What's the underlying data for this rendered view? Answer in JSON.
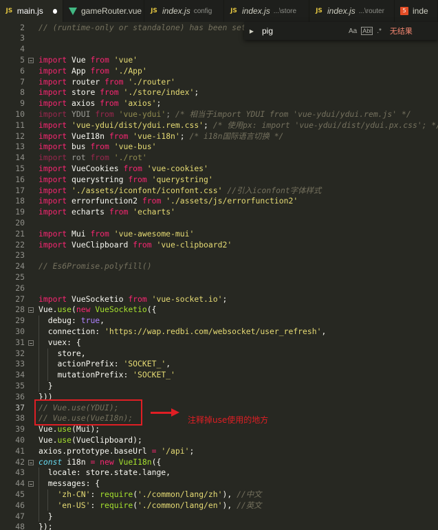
{
  "tabs": [
    {
      "label": "main.js",
      "icon": "js-file-icon",
      "active": true,
      "modified": true,
      "desc": ""
    },
    {
      "label": "gameRouter.vue",
      "icon": "vue-file-icon",
      "active": false,
      "modified": false,
      "desc": ""
    },
    {
      "label": "index.js",
      "icon": "js-file-icon",
      "active": false,
      "modified": false,
      "desc": "config"
    },
    {
      "label": "index.js",
      "icon": "js-file-icon",
      "active": false,
      "modified": false,
      "desc": "...\\store"
    },
    {
      "label": "index.js",
      "icon": "js-file-icon",
      "active": false,
      "modified": false,
      "desc": "...\\router"
    },
    {
      "label": "inde",
      "icon": "html-file-icon",
      "active": false,
      "modified": false,
      "desc": ""
    }
  ],
  "find": {
    "query": "pig",
    "match_case_label": "Aa",
    "whole_word_label": "Abl",
    "regex_label": ".*",
    "result": "无结果"
  },
  "annotation": {
    "note": "注释掉use使用的地方",
    "color": "#e01e24"
  },
  "code_lines": [
    {
      "n": "2",
      "html": "<span class='c'>// (runtime-only or standalone) has been set in</span>"
    },
    {
      "n": "3",
      "html": ""
    },
    {
      "n": "4",
      "html": ""
    },
    {
      "n": "5",
      "fold": true,
      "html": "<span class='k'>import</span> <span class='p'>Vue</span> <span class='k'>from</span> <span class='s'>'vue'</span>"
    },
    {
      "n": "6",
      "html": "<span class='k'>import</span> <span class='p'>App</span> <span class='k'>from</span> <span class='s'>'./App'</span>"
    },
    {
      "n": "7",
      "html": "<span class='k'>import</span> <span class='p'>router</span> <span class='k'>from</span> <span class='s'>'./router'</span>"
    },
    {
      "n": "8",
      "html": "<span class='k'>import</span> <span class='p'>store</span> <span class='k'>from</span> <span class='s'>'./store/index'</span><span class='p'>;</span>"
    },
    {
      "n": "9",
      "html": "<span class='k'>import</span> <span class='p'>axios</span> <span class='k'>from</span> <span class='s'>'axios'</span><span class='p'>;</span>"
    },
    {
      "n": "10",
      "html": "<span class='dim'><span class='k'>import</span> <span class='p'>YDUI</span> <span class='k'>from</span> <span class='s'>'vue-ydui'</span><span class='p'>;</span></span> <span class='c'>/* 相当于import YDUI from 'vue-ydui/ydui.rem.js' */</span>"
    },
    {
      "n": "11",
      "html": "<span class='k'>import</span> <span class='s'>'vue-ydui/dist/ydui.rem.css'</span><span class='p'>;</span> <span class='c'>/* 使用px: import 'vue-ydui/dist/ydui.px.css'; */</span>"
    },
    {
      "n": "12",
      "html": "<span class='k'>import</span> <span class='p'>VueI18n</span> <span class='k'>from</span> <span class='s'>'vue-i18n'</span><span class='p'>;</span> <span class='c'>/* i18n国际语言切换 */</span>"
    },
    {
      "n": "13",
      "html": "<span class='k'>import</span> <span class='p'>bus</span> <span class='k'>from</span> <span class='s'>'vue-bus'</span>"
    },
    {
      "n": "14",
      "html": "<span class='dim'><span class='k'>import</span> <span class='p'>rot</span> <span class='k'>from</span> <span class='s'>'./rot'</span></span>"
    },
    {
      "n": "15",
      "html": "<span class='k'>import</span> <span class='p'>VueCookies</span> <span class='k'>from</span> <span class='s'>'vue-cookies'</span>"
    },
    {
      "n": "16",
      "html": "<span class='k'>import</span> <span class='p'>querystring</span> <span class='k'>from</span> <span class='s'>'querystring'</span>"
    },
    {
      "n": "17",
      "html": "<span class='k'>import</span> <span class='s'>'./assets/iconfont/iconfont.css'</span> <span class='c'>//引入iconfont字体样式</span>"
    },
    {
      "n": "18",
      "html": "<span class='k'>import</span> <span class='p'>errorfunction2</span> <span class='k'>from</span> <span class='s'>'./assets/js/errorfunction2'</span>"
    },
    {
      "n": "19",
      "html": "<span class='k'>import</span> <span class='p'>echarts</span> <span class='k'>from</span> <span class='s'>'echarts'</span>"
    },
    {
      "n": "20",
      "html": ""
    },
    {
      "n": "21",
      "html": "<span class='k'>import</span> <span class='p'>Mui</span> <span class='k'>from</span> <span class='s'>'vue-awesome-mui'</span>"
    },
    {
      "n": "22",
      "html": "<span class='k'>import</span> <span class='p'>VueClipboard</span> <span class='k'>from</span> <span class='s'>'vue-clipboard2'</span>"
    },
    {
      "n": "23",
      "html": ""
    },
    {
      "n": "24",
      "html": "<span class='c'>// Es6Promise.polyfill()</span>"
    },
    {
      "n": "25",
      "html": ""
    },
    {
      "n": "26",
      "html": ""
    },
    {
      "n": "27",
      "html": "<span class='k'>import</span> <span class='p'>VueSocketio</span> <span class='k'>from</span> <span class='s'>'vue-socket.io'</span><span class='p'>;</span>"
    },
    {
      "n": "28",
      "fold": true,
      "html": "<span class='p'>Vue.</span><span class='f'>use</span><span class='p'>(</span><span class='k'>new</span> <span class='f'>VueSocketio</span><span class='p'>({</span>"
    },
    {
      "n": "29",
      "html": "  <span class='p'>debug:</span> <span class='b'>true</span><span class='p'>,</span>"
    },
    {
      "n": "30",
      "html": "  <span class='p'>connection:</span> <span class='s'>'https://wap.redbi.com/websocket/user_refresh'</span><span class='p'>,</span>"
    },
    {
      "n": "31",
      "fold": true,
      "html": "  <span class='p'>vuex: {</span>"
    },
    {
      "n": "32",
      "html": "    <span class='p'>store,</span>"
    },
    {
      "n": "33",
      "html": "    <span class='p'>actionPrefix:</span> <span class='s'>'SOCKET_'</span><span class='p'>,</span>"
    },
    {
      "n": "34",
      "html": "    <span class='p'>mutationPrefix:</span> <span class='s'>'SOCKET_'</span>"
    },
    {
      "n": "35",
      "html": "  <span class='p'>}</span>"
    },
    {
      "n": "36",
      "html": "<span class='p'>}))</span>"
    },
    {
      "n": "37",
      "cur": true,
      "html": "<span class='c'>// Vue.use(YDUI);</span>"
    },
    {
      "n": "38",
      "html": "<span class='c'>// Vue.use(VueI18n);</span>"
    },
    {
      "n": "39",
      "html": "<span class='p'>Vue.</span><span class='f'>use</span><span class='p'>(Mui);</span>"
    },
    {
      "n": "40",
      "html": "<span class='p'>Vue.</span><span class='f'>use</span><span class='p'>(VueClipboard);</span>"
    },
    {
      "n": "41",
      "html": "<span class='p'>axios.prototype.baseUrl</span> <span class='k'>=</span> <span class='s'>'/api'</span><span class='p'>;</span>"
    },
    {
      "n": "42",
      "fold": true,
      "html": "<span class='i'>const</span> <span class='p'>i18n</span> <span class='k'>=</span> <span class='k'>new</span> <span class='f'>VueI18n</span><span class='p'>({</span>"
    },
    {
      "n": "43",
      "html": "  <span class='p'>locale: store.state.lange,</span>"
    },
    {
      "n": "44",
      "fold": true,
      "html": "  <span class='p'>messages: {</span>"
    },
    {
      "n": "45",
      "html": "    <span class='s'>'zh-CN'</span><span class='p'>:</span> <span class='f'>require</span><span class='p'>(</span><span class='s'>'./common/lang/zh'</span><span class='p'>),</span> <span class='c'>//中文</span>"
    },
    {
      "n": "46",
      "html": "    <span class='s'>'en-US'</span><span class='p'>:</span> <span class='f'>require</span><span class='p'>(</span><span class='s'>'./common/lang/en'</span><span class='p'>),</span> <span class='c'>//英文</span>"
    },
    {
      "n": "47",
      "html": "  <span class='p'>}</span>"
    },
    {
      "n": "48",
      "html": "<span class='p'>});</span>"
    }
  ]
}
